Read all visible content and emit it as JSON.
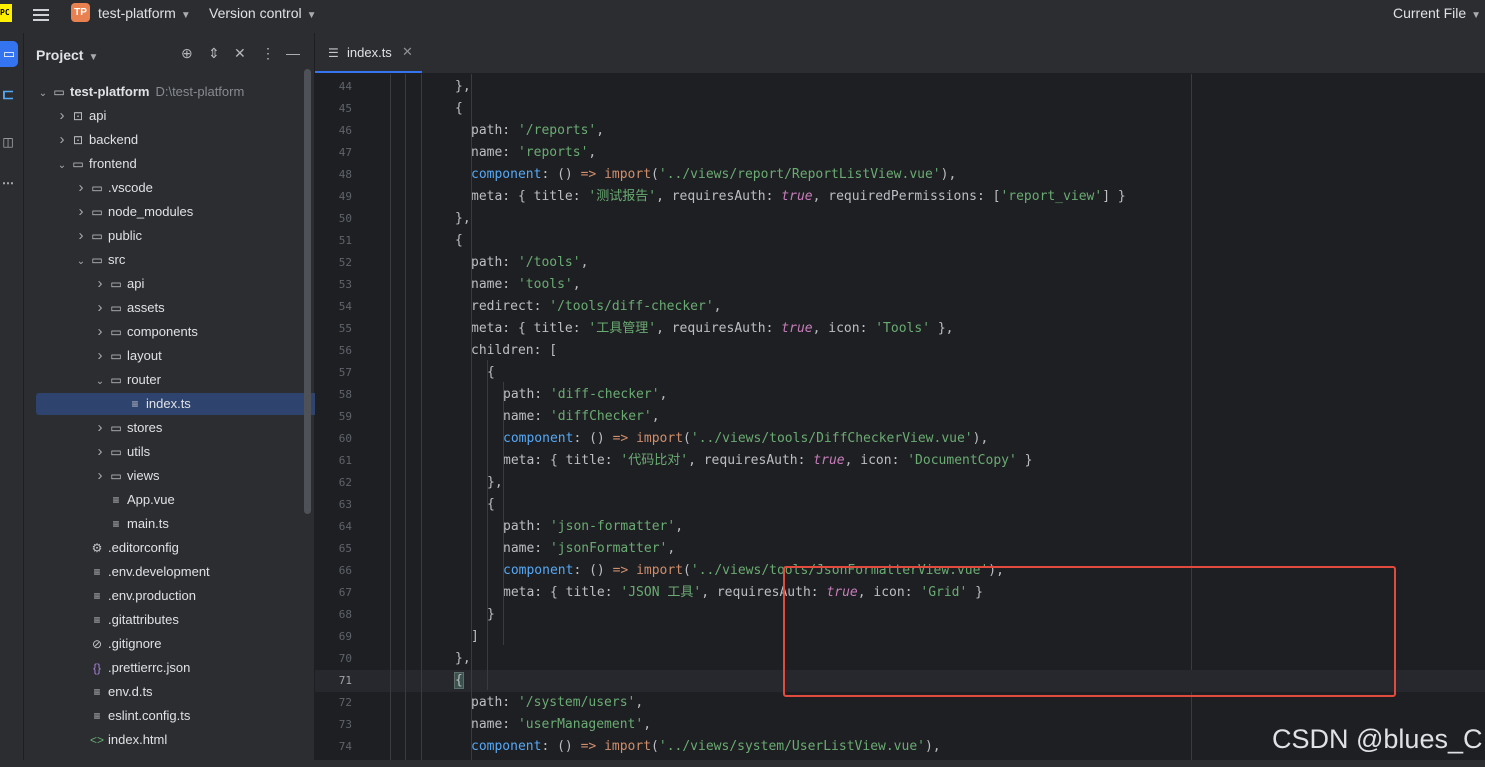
{
  "titlebar": {
    "app_logo": "PC",
    "project_badge": "TP",
    "project_name": "test-platform",
    "vcs_menu": "Version control",
    "run_config": "Current File",
    "chevron_icon": "chevron-down-icon"
  },
  "project_panel": {
    "title": "Project",
    "icons": [
      "locate-icon",
      "expand-icon",
      "collapse-icon",
      "more-icon",
      "minimize-icon"
    ],
    "tree": [
      {
        "label": "test-platform",
        "path": "D:\\test-platform",
        "icon": "folder-icon",
        "expanded": true
      },
      {
        "label": "api",
        "icon": "module-folder-icon",
        "expanded": false
      },
      {
        "label": "backend",
        "icon": "module-folder-icon",
        "expanded": false
      },
      {
        "label": "frontend",
        "icon": "folder-icon",
        "expanded": true
      },
      {
        "label": ".vscode",
        "icon": "folder-icon",
        "expanded": false
      },
      {
        "label": "node_modules",
        "icon": "folder-icon",
        "expanded": false
      },
      {
        "label": "public",
        "icon": "folder-icon",
        "expanded": false
      },
      {
        "label": "src",
        "icon": "folder-icon",
        "expanded": true
      },
      {
        "label": "api",
        "icon": "folder-icon",
        "expanded": false
      },
      {
        "label": "assets",
        "icon": "folder-icon",
        "expanded": false
      },
      {
        "label": "components",
        "icon": "folder-icon",
        "expanded": false
      },
      {
        "label": "layout",
        "icon": "folder-icon",
        "expanded": false
      },
      {
        "label": "router",
        "icon": "folder-icon",
        "expanded": true
      },
      {
        "label": "index.ts",
        "icon": "file-icon",
        "selected": true
      },
      {
        "label": "stores",
        "icon": "folder-icon",
        "expanded": false
      },
      {
        "label": "utils",
        "icon": "folder-icon",
        "expanded": false
      },
      {
        "label": "views",
        "icon": "folder-icon",
        "expanded": false
      },
      {
        "label": "App.vue",
        "icon": "file-icon"
      },
      {
        "label": "main.ts",
        "icon": "file-icon"
      },
      {
        "label": ".editorconfig",
        "icon": "gear-icon"
      },
      {
        "label": ".env.development",
        "icon": "file-icon"
      },
      {
        "label": ".env.production",
        "icon": "file-icon"
      },
      {
        "label": ".gitattributes",
        "icon": "file-icon"
      },
      {
        "label": ".gitignore",
        "icon": "ignore-icon"
      },
      {
        "label": ".prettierrc.json",
        "icon": "json-icon"
      },
      {
        "label": "env.d.ts",
        "icon": "file-icon"
      },
      {
        "label": "eslint.config.ts",
        "icon": "file-icon"
      },
      {
        "label": "index.html",
        "icon": "html-icon"
      }
    ]
  },
  "tabs": [
    {
      "label": "index.ts",
      "icon": "file-icon",
      "active": true
    }
  ],
  "editor": {
    "current_line": 71,
    "lines": [
      {
        "n": "44",
        "text": "},"
      },
      {
        "n": "45",
        "text": "{"
      },
      {
        "n": "46",
        "text": "path: '/reports',"
      },
      {
        "n": "47",
        "text": "name: 'reports',"
      },
      {
        "n": "48",
        "text": "component: () => import('../views/report/ReportListView.vue'),"
      },
      {
        "n": "49",
        "text": "meta: { title: '测试报告', requiresAuth: true, requiredPermissions: ['report_view'] }"
      },
      {
        "n": "50",
        "text": "},"
      },
      {
        "n": "51",
        "text": "{"
      },
      {
        "n": "52",
        "text": "path: '/tools',"
      },
      {
        "n": "53",
        "text": "name: 'tools',"
      },
      {
        "n": "54",
        "text": "redirect: '/tools/diff-checker',"
      },
      {
        "n": "55",
        "text": "meta: { title: '工具管理', requiresAuth: true, icon: 'Tools' },"
      },
      {
        "n": "56",
        "text": "children: ["
      },
      {
        "n": "57",
        "text": "{"
      },
      {
        "n": "58",
        "text": "path: 'diff-checker',"
      },
      {
        "n": "59",
        "text": "name: 'diffChecker',"
      },
      {
        "n": "60",
        "text": "component: () => import('../views/tools/DiffCheckerView.vue'),"
      },
      {
        "n": "61",
        "text": "meta: { title: '代码比对', requiresAuth: true, icon: 'DocumentCopy' }"
      },
      {
        "n": "62",
        "text": "},"
      },
      {
        "n": "63",
        "text": "{"
      },
      {
        "n": "64",
        "text": "path: 'json-formatter',"
      },
      {
        "n": "65",
        "text": "name: 'jsonFormatter',"
      },
      {
        "n": "66",
        "text": "component: () => import('../views/tools/JsonFormatterView.vue'),"
      },
      {
        "n": "67",
        "text": "meta: { title: 'JSON 工具', requiresAuth: true, icon: 'Grid' }"
      },
      {
        "n": "68",
        "text": "}"
      },
      {
        "n": "69",
        "text": "]"
      },
      {
        "n": "70",
        "text": "},"
      },
      {
        "n": "71",
        "text": "{"
      },
      {
        "n": "72",
        "text": "path: '/system/users',"
      },
      {
        "n": "73",
        "text": "name: 'userManagement',"
      },
      {
        "n": "74",
        "text": "component: () => import('../views/system/UserListView.vue'),"
      }
    ]
  },
  "watermark": "CSDN @blues_C",
  "colors": {
    "keyword": "#cf8e6d",
    "string": "#6aab73",
    "method": "#56a8f5",
    "literal": "#c77dbb",
    "highlight_box": "#e04b3e",
    "selection": "#2e436e",
    "accent": "#3574f0"
  }
}
